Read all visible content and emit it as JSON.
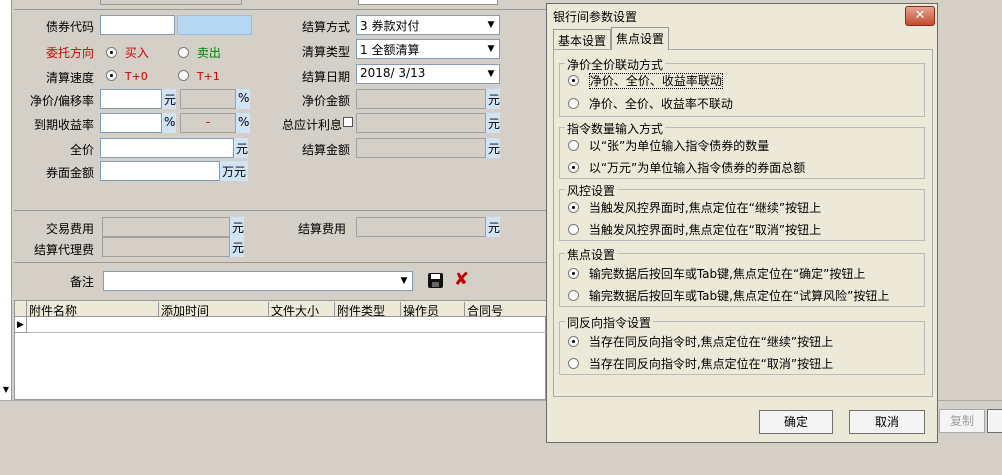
{
  "form": {
    "bond_code_label": "债券代码",
    "direction_label": "委托方向",
    "direction_buy": "买入",
    "direction_sell": "卖出",
    "speed_label": "清算速度",
    "speed_t0": "T+0",
    "speed_t1": "T+1",
    "net_price_label": "净价/偏移率",
    "ytm_label": "到期收益率",
    "full_price_label": "全价",
    "face_amount_label": "券面金额",
    "settle_method_label": "结算方式",
    "settle_method_value": "3  券款对付",
    "clear_type_label": "清算类型",
    "clear_type_value": "1  全额清算",
    "settle_date_label": "结算日期",
    "settle_date_value": "2018/ 3/13",
    "net_amount_label": "净价金额",
    "accrued_label": "总应计利息",
    "settle_amount_label": "结算金额",
    "trade_fee_label": "交易费用",
    "settle_fee_label": "结算费用",
    "agent_fee_label": "结算代理费",
    "remark_label": "备注",
    "dash": "-",
    "unit_yuan": "元",
    "unit_pct": "%",
    "unit_wanyuan": "万元"
  },
  "attachments": {
    "headers": [
      "附件名称",
      "添加时间",
      "文件大小",
      "附件类型",
      "操作员",
      "合同号"
    ]
  },
  "right_edge": {
    "copy_button": "复制"
  },
  "dialog": {
    "title": "银行间参数设置",
    "tabs": [
      "基本设置",
      "焦点设置"
    ],
    "groups": [
      {
        "title": "净价全价联动方式",
        "options": [
          "净价、全价、收益率联动",
          "净价、全价、收益率不联动"
        ],
        "selected": 0
      },
      {
        "title": "指令数量输入方式",
        "options": [
          "以“张”为单位输入指令债券的数量",
          "以“万元”为单位输入指令债券的券面总额"
        ],
        "selected": 1
      },
      {
        "title": "风控设置",
        "options": [
          "当触发风控界面时,焦点定位在“继续”按钮上",
          "当触发风控界面时,焦点定位在“取消”按钮上"
        ],
        "selected": 0
      },
      {
        "title": "焦点设置",
        "options": [
          "输完数据后按回车或Tab键,焦点定位在“确定”按钮上",
          "输完数据后按回车或Tab键,焦点定位在“试算风险”按钮上"
        ],
        "selected": 0
      },
      {
        "title": "同反向指令设置",
        "options": [
          "当存在同反向指令时,焦点定位在“继续”按钮上",
          "当存在同反向指令时,焦点定位在“取消”按钮上"
        ],
        "selected": 0
      }
    ],
    "ok_label": "确定",
    "cancel_label": "取消"
  },
  "colors": {
    "direction_red": "#d00000",
    "sell_green": "#008000",
    "tplus_red": "#d00000",
    "delete_red": "#c00000"
  }
}
